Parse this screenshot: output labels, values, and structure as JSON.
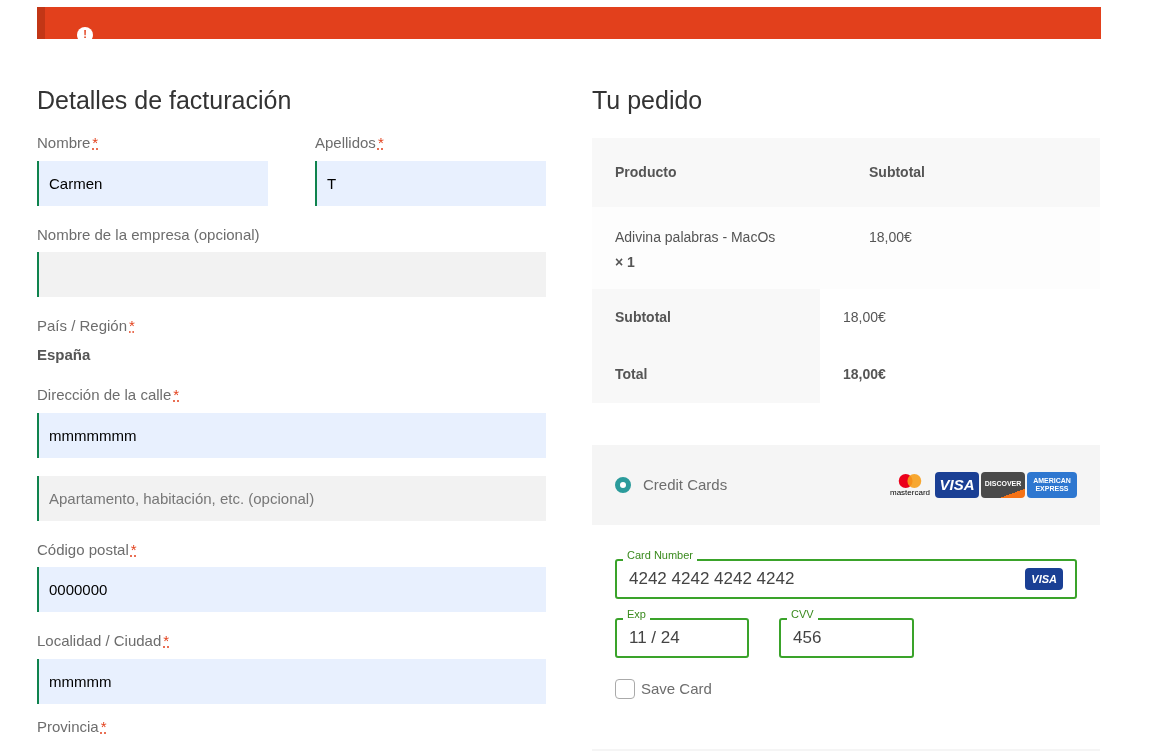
{
  "error_banner": {
    "icon": "!"
  },
  "billing": {
    "title": "Detalles de facturación",
    "name_row": [
      {
        "label": "Nombre",
        "required_mark": "*",
        "value": "Carmen",
        "autofilled": true
      },
      {
        "label": "Apellidos",
        "required_mark": "*",
        "value": "T",
        "autofilled": true
      }
    ],
    "fields": [
      {
        "kind": "input",
        "label": "Nombre de la empresa (opcional)",
        "autofilled": false
      },
      {
        "kind": "static",
        "label": "País / Región",
        "required_mark": "*",
        "value": "España"
      },
      {
        "kind": "input",
        "label": "Dirección de la calle",
        "required_mark": "*",
        "value": "mmmmmmm",
        "autofilled": true
      },
      {
        "kind": "input",
        "placeholder": "Apartamento, habitación, etc. (opcional)",
        "autofilled": false
      },
      {
        "kind": "input",
        "label": "Código postal",
        "required_mark": "*",
        "value": "0000000",
        "autofilled": true
      },
      {
        "kind": "input",
        "label": "Localidad / Ciudad",
        "required_mark": "*",
        "value": "mmmmm",
        "autofilled": true
      },
      {
        "kind": "heading",
        "label": "Provincia",
        "required_mark": "*"
      }
    ]
  },
  "order": {
    "title": "Tu pedido",
    "columns": [
      "Producto",
      "Subtotal"
    ],
    "items": [
      {
        "product": "Adivina palabras - MacOs",
        "quantity": "× 1",
        "subtotal": "18,00€"
      }
    ],
    "totals": [
      {
        "label": "Subtotal",
        "value": "18,00€",
        "bold": false
      },
      {
        "label": "Total",
        "value": "18,00€",
        "bold": true
      }
    ]
  },
  "payment": {
    "method": {
      "label": "Credit Cards",
      "selected": true
    },
    "brands": [
      {
        "kind": "mastercard",
        "label": "mastercard"
      },
      {
        "kind": "visa",
        "label": "VISA"
      },
      {
        "kind": "discover",
        "label": "DISCOVER"
      },
      {
        "kind": "amex",
        "label": "AMERICAN EXPRESS"
      }
    ],
    "card_number": {
      "label": "Card Number",
      "value": "4242 4242 4242 4242",
      "brand": "VISA"
    },
    "exp": {
      "label": "Exp",
      "value": "11 / 24"
    },
    "cvv": {
      "label": "CVV",
      "value": "456"
    },
    "save_card": {
      "label": "Save Card",
      "checked": false
    }
  }
}
